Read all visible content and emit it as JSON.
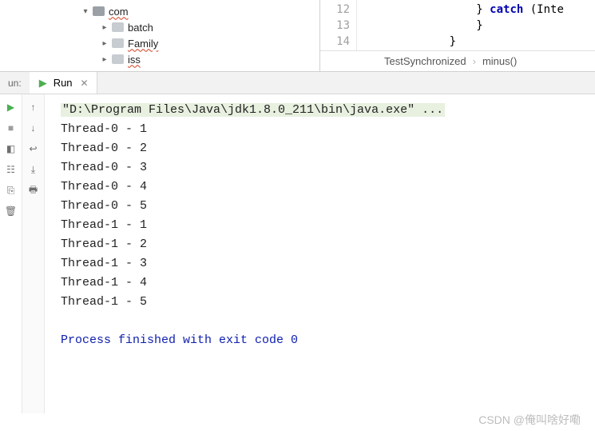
{
  "tree": {
    "items": [
      {
        "label": "com",
        "wavy": true
      },
      {
        "label": "batch"
      },
      {
        "label": "Family",
        "wavy": true
      },
      {
        "label": "iss",
        "wavy": true
      }
    ]
  },
  "editor": {
    "lines": {
      "n12": "12",
      "c12a": "} ",
      "c12kw": "catch",
      "c12b": " (Inte",
      "n13": "13",
      "c13": "}",
      "n14": "14",
      "c14": "}"
    }
  },
  "breadcrumb": {
    "class": "TestSynchronized",
    "method": "minus()"
  },
  "runbar": {
    "label": "un:",
    "tab": "Run"
  },
  "console": {
    "cmd": "\"D:\\Program Files\\Java\\jdk1.8.0_211\\bin\\java.exe\" ...",
    "lines": [
      "Thread-0 - 1",
      "Thread-0 - 2",
      "Thread-0 - 3",
      "Thread-0 - 4",
      "Thread-0 - 5",
      "Thread-1 - 1",
      "Thread-1 - 2",
      "Thread-1 - 3",
      "Thread-1 - 4",
      "Thread-1 - 5"
    ],
    "exit": "Process finished with exit code 0"
  },
  "watermark": "CSDN @俺叫啥好嘞"
}
